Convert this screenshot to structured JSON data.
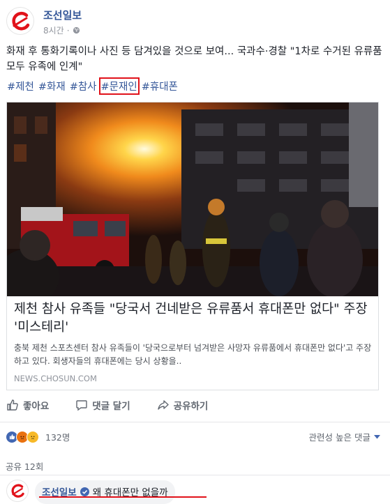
{
  "post": {
    "page_name": "조선일보",
    "time": "8시간",
    "privacy_icon": "globe-icon",
    "text": "화재 후 통화기록이나 사진 등 담겨있을 것으로 보여... 국과수·경찰 \"1차로 수거된 유류품 모두 유족에 인계\"",
    "hashtags": [
      "#제천",
      "#화재",
      "#참사",
      "#문재인",
      "#휴대폰"
    ],
    "highlighted_hashtag": "#문재인"
  },
  "card": {
    "title": "제천 참사 유족들 \"당국서 건네받은 유류품서 휴대폰만 없다\" 주장 '미스테리'",
    "description": "충북 제천 스포츠센터 참사 유족들이 '당국으로부터 넘겨받은 사망자 유류품에서 휴대폰만 없다'고 주장하고 있다. 회생자들의 휴대폰에는 당시 상황을..",
    "domain": "NEWS.CHOSUN.COM"
  },
  "actions": {
    "like": "좋아요",
    "comment": "댓글 달기",
    "share": "공유하기"
  },
  "reactions": {
    "count": "132명",
    "sort_label": "관련성 높은 댓글",
    "shares": "공유 12회"
  },
  "comment": {
    "author": "조선일보",
    "text": "왜 휴대폰만 없을까"
  },
  "colors": {
    "link": "#365899",
    "highlight": "#e1121a",
    "logo": "#e1121a"
  }
}
